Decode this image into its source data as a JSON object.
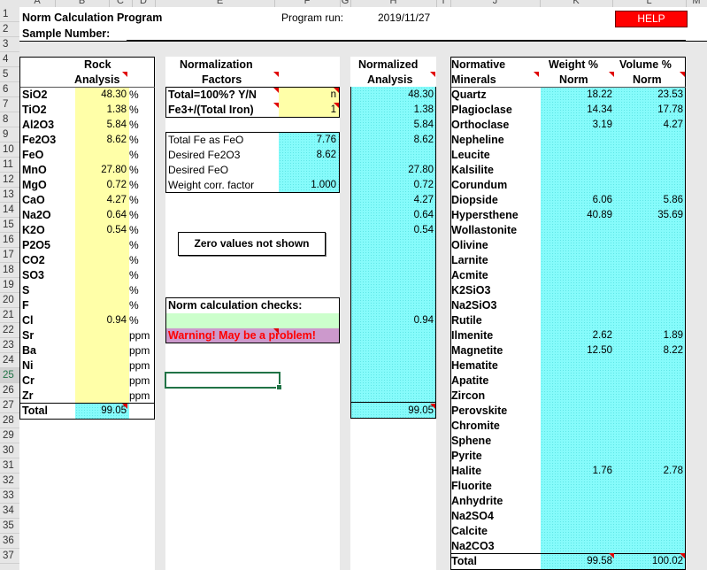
{
  "columns": [
    "A",
    "B",
    "C",
    "D",
    "E",
    "F",
    "G",
    "H",
    "I",
    "J",
    "K",
    "L",
    "M"
  ],
  "rows": [
    "1",
    "2",
    "3",
    "4",
    "5",
    "6",
    "7",
    "8",
    "9",
    "10",
    "11",
    "12",
    "13",
    "14",
    "15",
    "16",
    "17",
    "18",
    "19",
    "20",
    "21",
    "22",
    "23",
    "24",
    "25",
    "26",
    "27",
    "28",
    "29",
    "30",
    "31",
    "32",
    "33",
    "34",
    "35",
    "36",
    "37"
  ],
  "header": {
    "title": "Norm Calculation Program",
    "sample_label": "Sample Number:",
    "program_run_label": "Program run:",
    "program_run_date": "2019/11/27",
    "help_label": "HELP"
  },
  "rock": {
    "head1": "Rock",
    "head2": "Analysis",
    "items": [
      {
        "name": "SiO2",
        "value": "48.30",
        "unit": "%"
      },
      {
        "name": "TiO2",
        "value": "1.38",
        "unit": "%"
      },
      {
        "name": "Al2O3",
        "value": "5.84",
        "unit": "%"
      },
      {
        "name": "Fe2O3",
        "value": "8.62",
        "unit": "%"
      },
      {
        "name": "FeO",
        "value": "",
        "unit": "%"
      },
      {
        "name": "MnO",
        "value": "27.80",
        "unit": "%"
      },
      {
        "name": "MgO",
        "value": "0.72",
        "unit": "%"
      },
      {
        "name": "CaO",
        "value": "4.27",
        "unit": "%"
      },
      {
        "name": "Na2O",
        "value": "0.64",
        "unit": "%"
      },
      {
        "name": "K2O",
        "value": "0.54",
        "unit": "%"
      },
      {
        "name": "P2O5",
        "value": "",
        "unit": "%"
      },
      {
        "name": "CO2",
        "value": "",
        "unit": "%"
      },
      {
        "name": "SO3",
        "value": "",
        "unit": "%"
      },
      {
        "name": "S",
        "value": "",
        "unit": "%"
      },
      {
        "name": "F",
        "value": "",
        "unit": "%"
      },
      {
        "name": "Cl",
        "value": "0.94",
        "unit": "%"
      },
      {
        "name": "Sr",
        "value": "",
        "unit": "ppm"
      },
      {
        "name": "Ba",
        "value": "",
        "unit": "ppm"
      },
      {
        "name": "Ni",
        "value": "",
        "unit": "ppm"
      },
      {
        "name": "Cr",
        "value": "",
        "unit": "ppm"
      },
      {
        "name": "Zr",
        "value": "",
        "unit": "ppm"
      }
    ],
    "total_label": "Total",
    "total_value": "99.05"
  },
  "normalization": {
    "head1": "Normalization",
    "head2": "Factors",
    "total100_label": "Total=100%? Y/N",
    "total100_value": "n",
    "fe_ratio_label": "Fe3+/(Total Iron)",
    "fe_ratio_value": "1",
    "factors": [
      {
        "label": "Total Fe as FeO",
        "value": "7.76"
      },
      {
        "label": "Desired Fe2O3",
        "value": "8.62"
      },
      {
        "label": "Desired FeO",
        "value": ""
      },
      {
        "label": "Weight corr. factor",
        "value": "1.000"
      }
    ],
    "zero_values": "Zero values not shown",
    "checks_label": "Norm calculation checks:",
    "warning": "Warning! May be a problem!"
  },
  "normalized": {
    "head1": "Normalized",
    "head2": "Analysis",
    "values": [
      "48.30",
      "1.38",
      "5.84",
      "8.62",
      "",
      "27.80",
      "0.72",
      "4.27",
      "0.64",
      "0.54",
      "",
      "",
      "",
      "",
      "",
      "0.94",
      "",
      "",
      "",
      "",
      ""
    ],
    "total": "99.05"
  },
  "minerals": {
    "head1": "Normative",
    "head2": "Minerals",
    "weight_head1": "Weight %",
    "weight_head2": "Norm",
    "volume_head1": "Volume %",
    "volume_head2": "Norm",
    "items": [
      {
        "name": "Quartz",
        "weight": "18.22",
        "volume": "23.53"
      },
      {
        "name": "Plagioclase",
        "weight": "14.34",
        "volume": "17.78"
      },
      {
        "name": "Orthoclase",
        "weight": "3.19",
        "volume": "4.27"
      },
      {
        "name": "Nepheline",
        "weight": "",
        "volume": ""
      },
      {
        "name": "Leucite",
        "weight": "",
        "volume": ""
      },
      {
        "name": "Kalsilite",
        "weight": "",
        "volume": ""
      },
      {
        "name": "Corundum",
        "weight": "",
        "volume": ""
      },
      {
        "name": "Diopside",
        "weight": "6.06",
        "volume": "5.86"
      },
      {
        "name": "Hypersthene",
        "weight": "40.89",
        "volume": "35.69"
      },
      {
        "name": "Wollastonite",
        "weight": "",
        "volume": ""
      },
      {
        "name": "Olivine",
        "weight": "",
        "volume": ""
      },
      {
        "name": "Larnite",
        "weight": "",
        "volume": ""
      },
      {
        "name": "Acmite",
        "weight": "",
        "volume": ""
      },
      {
        "name": "K2SiO3",
        "weight": "",
        "volume": ""
      },
      {
        "name": "Na2SiO3",
        "weight": "",
        "volume": ""
      },
      {
        "name": "Rutile",
        "weight": "",
        "volume": ""
      },
      {
        "name": "Ilmenite",
        "weight": "2.62",
        "volume": "1.89"
      },
      {
        "name": "Magnetite",
        "weight": "12.50",
        "volume": "8.22"
      },
      {
        "name": "Hematite",
        "weight": "",
        "volume": ""
      },
      {
        "name": "Apatite",
        "weight": "",
        "volume": ""
      },
      {
        "name": "Zircon",
        "weight": "",
        "volume": ""
      },
      {
        "name": "Perovskite",
        "weight": "",
        "volume": ""
      },
      {
        "name": "Chromite",
        "weight": "",
        "volume": ""
      },
      {
        "name": "Sphene",
        "weight": "",
        "volume": ""
      },
      {
        "name": "Pyrite",
        "weight": "",
        "volume": ""
      },
      {
        "name": "Halite",
        "weight": "1.76",
        "volume": "2.78"
      },
      {
        "name": "Fluorite",
        "weight": "",
        "volume": ""
      },
      {
        "name": "Anhydrite",
        "weight": "",
        "volume": ""
      },
      {
        "name": "Na2SO4",
        "weight": "",
        "volume": ""
      },
      {
        "name": "Calcite",
        "weight": "",
        "volume": ""
      },
      {
        "name": "Na2CO3",
        "weight": "",
        "volume": ""
      }
    ],
    "total_label": "Total",
    "weight_total": "99.58",
    "volume_total": "100.02"
  },
  "colors": {
    "help": "#ff0000",
    "input": "#ffffa8",
    "output": "#86fbfb",
    "check": "#ccffcc",
    "warning_bg": "#cc99cc",
    "warning_text": "#ff0000",
    "selection": "#217346"
  }
}
